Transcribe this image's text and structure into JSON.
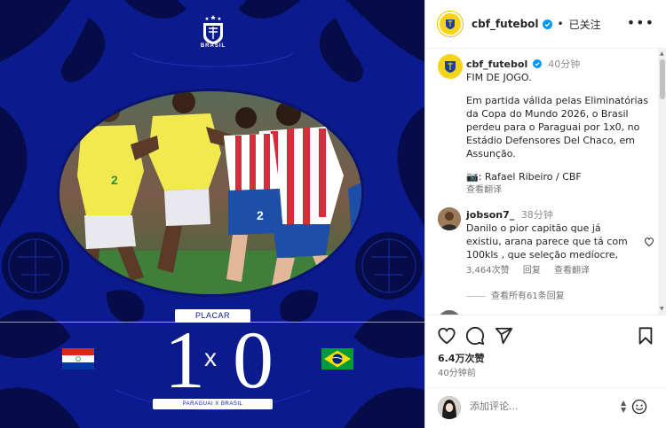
{
  "post_image": {
    "crest_text": "BRASIL",
    "placar_label": "PLACAR",
    "score_home": "1",
    "score_separator": "x",
    "score_away": "0",
    "teams_label": "PARAGUAI  X  BRASIL"
  },
  "header": {
    "username": "cbf_futebol",
    "follow_status": "已关注",
    "dot": "•"
  },
  "caption": {
    "username": "cbf_futebol",
    "time": "40分钟",
    "line1": "FIM DE JOGO.",
    "body": "Em partida válida pelas Eliminatórias da Copa do Mundo 2026, o Brasil perdeu para o Paraguai por 1x0, no Estádio Defensores Del Chaco, em Assunção.",
    "credit": "📷: Rafael Ribeiro / CBF",
    "see_translation": "查看翻译"
  },
  "comment": {
    "username": "jobson7_",
    "time": "38分钟",
    "text": "Danilo o pior capitão que já existiu, arana parece que tá com 100kls , que seleção medíocre,",
    "likes": "3,464次赞",
    "reply": "回复",
    "see_translation": "查看翻译",
    "view_replies": "查看所有61条回复"
  },
  "actions": {
    "likes": "6.4万次赞",
    "ago": "40分钟前"
  },
  "composer": {
    "placeholder": "添加评论..."
  },
  "colors": {
    "brand_blue": "#0b1a8c",
    "accent_yellow": "#f7d417",
    "verified_blue": "#0095f6"
  }
}
